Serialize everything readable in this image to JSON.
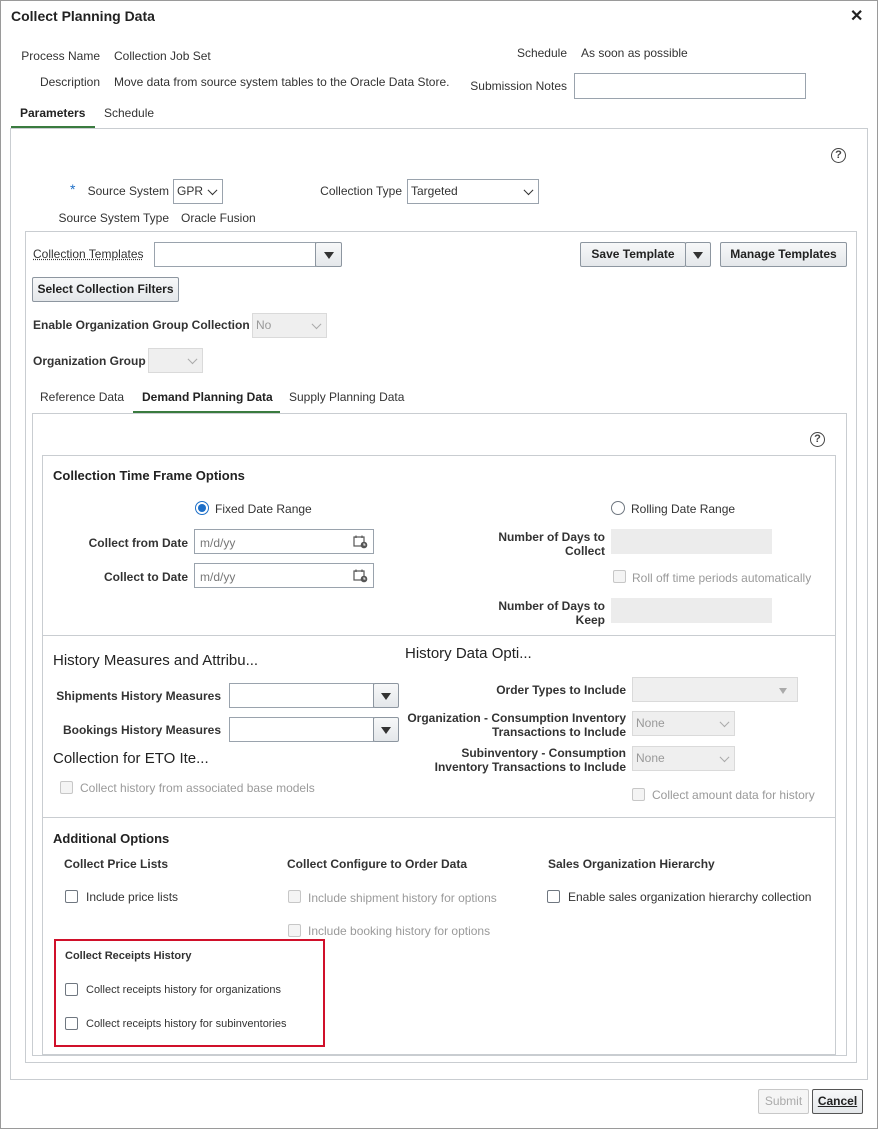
{
  "dialog": {
    "title": "Collect Planning Data"
  },
  "header": {
    "process_name_label": "Process Name",
    "process_name_value": "Collection Job Set",
    "description_label": "Description",
    "description_value": "Move data from source system tables to the Oracle Data Store.",
    "schedule_label": "Schedule",
    "schedule_value": "As soon as possible",
    "submission_notes_label": "Submission Notes",
    "submission_notes_value": ""
  },
  "tabs": [
    {
      "label": "Parameters",
      "selected": true
    },
    {
      "label": "Schedule",
      "selected": false
    }
  ],
  "params": {
    "required_marker": "*",
    "source_system_label": "Source System",
    "source_system_value": "GPR",
    "collection_type_label": "Collection Type",
    "collection_type_value": "Targeted",
    "source_system_type_label": "Source System Type",
    "source_system_type_value": "Oracle Fusion",
    "collection_templates_label": "Collection Templates",
    "collection_templates_value": "",
    "save_template": "Save Template",
    "manage_templates": "Manage Templates",
    "select_collection_filters": "Select Collection Filters",
    "enable_org_group_label": "Enable Organization Group Collection",
    "enable_org_group_value": "No",
    "org_group_label": "Organization Group",
    "org_group_value": ""
  },
  "subtabs": [
    {
      "label": "Reference Data",
      "selected": false
    },
    {
      "label": "Demand Planning Data",
      "selected": true
    },
    {
      "label": "Supply Planning Data",
      "selected": false
    }
  ],
  "timeframe": {
    "title": "Collection Time Frame Options",
    "fixed_label": "Fixed Date Range",
    "rolling_label": "Rolling Date Range",
    "from_label": "Collect from Date",
    "to_label": "Collect to Date",
    "date_placeholder": "m/d/yy",
    "days_collect_line1": "Number of Days to",
    "days_collect_line2": "Collect",
    "rolloff_label": "Roll off time periods automatically",
    "days_keep_line1": "Number of Days to",
    "days_keep_line2": "Keep"
  },
  "history": {
    "measures_title": "History Measures and Attribu...",
    "data_options_title": "History Data Opti...",
    "shipments_label": "Shipments History Measures",
    "bookings_label": "Bookings History Measures",
    "order_types_label": "Order Types to Include",
    "org_consumption_line1": "Organization - Consumption Inventory",
    "org_consumption_line2": "Transactions to Include",
    "org_consumption_value": "None",
    "subinv_consumption_line1": "Subinventory - Consumption",
    "subinv_consumption_line2": "Inventory Transactions to Include",
    "subinv_consumption_value": "None",
    "eto_title": "Collection for ETO Ite...",
    "eto_checkbox": "Collect history from associated base models",
    "amount_checkbox": "Collect amount data for history"
  },
  "additional": {
    "title": "Additional Options",
    "price_lists_title": "Collect Price Lists",
    "include_price_lists": "Include price lists",
    "cto_title": "Collect Configure to Order Data",
    "shipment_options": "Include shipment history for options",
    "booking_options": "Include booking history for options",
    "sales_org_title": "Sales Organization Hierarchy",
    "sales_org_checkbox": "Enable sales organization hierarchy collection",
    "receipts_title": "Collect Receipts History",
    "receipts_orgs": "Collect receipts history for organizations",
    "receipts_subinv": "Collect receipts history for subinventories"
  },
  "footer": {
    "submit": "Submit",
    "cancel": "Cancel"
  },
  "colors": {
    "accent_green": "#3a7b3f",
    "radio_blue": "#1d6fc8",
    "highlight_red": "#d0102a"
  }
}
